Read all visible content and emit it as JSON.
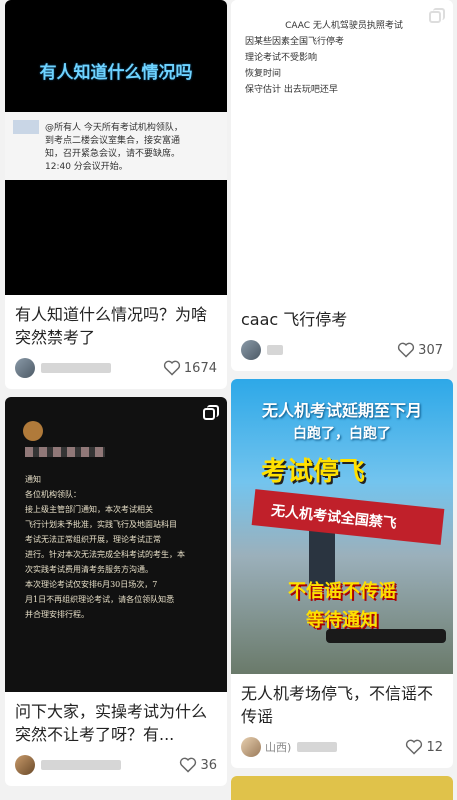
{
  "cards": [
    {
      "overlay": "有人知道什么情况吗",
      "message_lines": [
        "@所有人 今天所有考试机构领队，",
        "到考点二楼会议室集合，接安富通",
        "知，召开紧急会议，请不要缺席。",
        "12:40 分会议开始。"
      ],
      "title": "有人知道什么情况吗？为啥突然禁考了",
      "likes": "1674"
    },
    {
      "notice_header": "CAAC 无人机驾驶员执照考试",
      "notice_lines": [
        "因某些因素全国飞行停考",
        "理论考试不受影响",
        "恢复时间",
        "保守估计 出去玩吧还早"
      ],
      "title": "caac 飞行停考",
      "likes": "307"
    },
    {
      "doc_lines": [
        "通知",
        "各位机构领队：",
        "接上级主管部门通知，本次考试相关",
        "飞行计划未予批准，实践飞行及地面站科目",
        "考试无法正常组织开展，理论考试正常",
        "进行。针对本次无法完成全科考试的考生，本",
        "次实践考试费用清考务服务方沟通。",
        "本次理论考试仅安排6月30日场次，7",
        "月1日不再组织理论考试，请各位领队知悉",
        "并合理安排行程。"
      ],
      "title": "问下大家，实操考试为什么突然不让考了呀？有...",
      "likes": "36"
    },
    {
      "headline": "无人机考试延期至下月",
      "subline": "白跑了，白跑了",
      "big": "考试停飞",
      "banner": "无人机考试全国禁飞",
      "slogan1": "不信谣不传谣",
      "slogan2": "等待通知",
      "title": "无人机考场停飞，不信谣不传谣",
      "author_region": "山西)",
      "likes": "12"
    }
  ],
  "colors": {
    "overlay_blue": "#6fd3ff",
    "banner_red": "#c0202a",
    "slogan_yellow": "#ffe000"
  },
  "icons": [
    "multi-image-icon",
    "heart-icon",
    "avatar"
  ]
}
